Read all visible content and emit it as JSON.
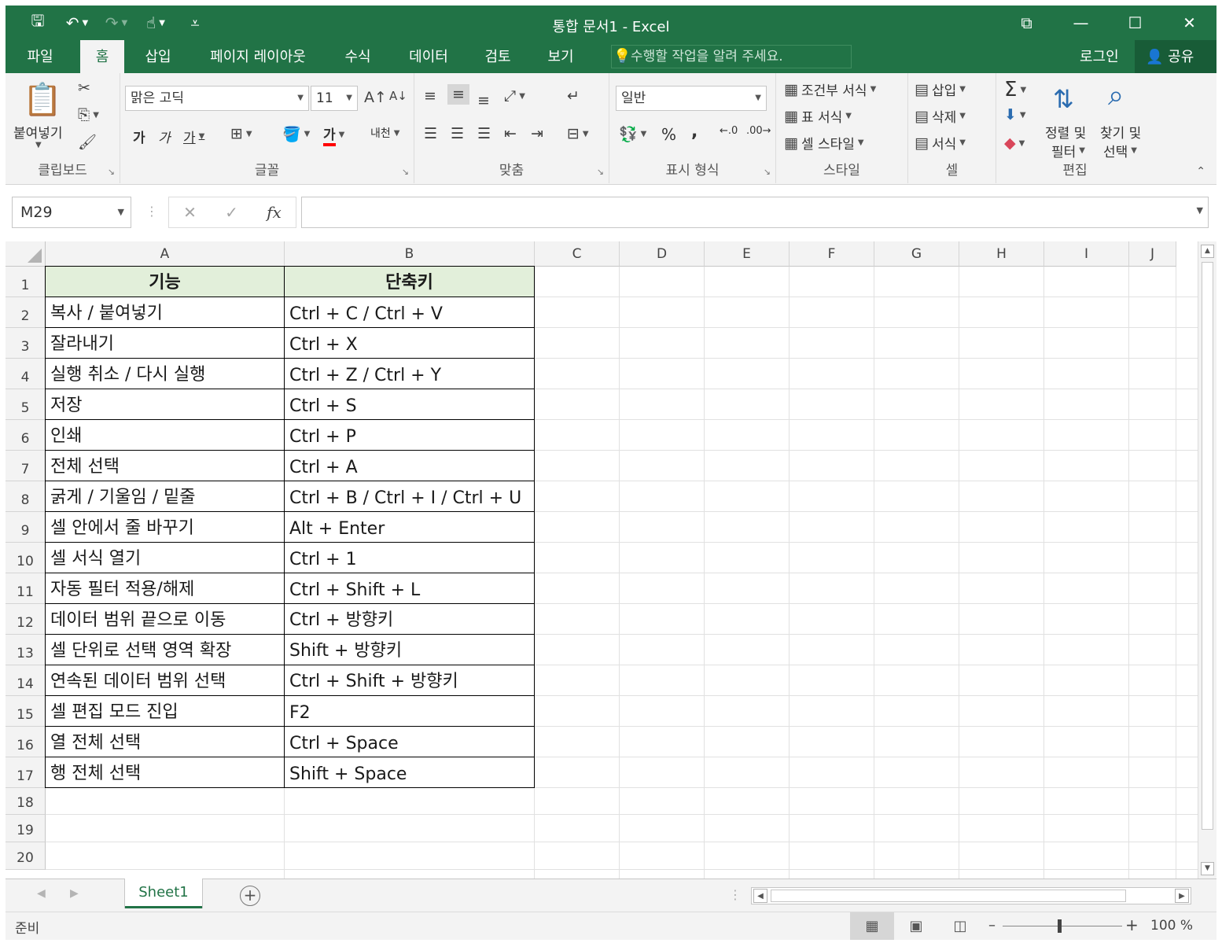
{
  "window": {
    "title": "통합 문서1 - Excel",
    "controls": [
      "⧉",
      "—",
      "☐",
      "✕"
    ]
  },
  "qat": {
    "save": "🖫",
    "undo": "↶",
    "redo": "↷",
    "touch": "☝",
    "customize": "⩡"
  },
  "tabs": [
    "파일",
    "홈",
    "삽입",
    "페이지 레이아웃",
    "수식",
    "데이터",
    "검토",
    "보기"
  ],
  "active_tab": "홈",
  "tellme": {
    "placeholder": "수행할 작업을 알려 주세요."
  },
  "account": {
    "login": "로그인",
    "share": "공유"
  },
  "ribbon": {
    "clipboard": {
      "label": "클립보드",
      "paste": "붙여넣기"
    },
    "font": {
      "label": "글꼴",
      "font_name": "맑은 고딕",
      "font_size": "11",
      "bold": "가",
      "italic": "가",
      "underline": "가",
      "font_color": "가",
      "phonetic": "내천"
    },
    "alignment": {
      "label": "맞춤"
    },
    "number": {
      "label": "표시 형식",
      "format": "일반",
      "percent": "%",
      "comma": ","
    },
    "styles": {
      "label": "스타일",
      "conditional": "조건부 서식",
      "table": "표 서식",
      "cell_styles": "셀 스타일"
    },
    "cells": {
      "label": "셀",
      "insert": "삽입",
      "delete": "삭제",
      "format": "서식"
    },
    "editing": {
      "label": "편집",
      "sort_filter_1": "정렬 및",
      "sort_filter_2": "필터",
      "find_1": "찾기 및",
      "find_2": "선택"
    }
  },
  "formula_bar": {
    "name_box": "M29",
    "content": ""
  },
  "columns": [
    "A",
    "B",
    "C",
    "D",
    "E",
    "F",
    "G",
    "H",
    "I",
    "J"
  ],
  "rows": [
    "1",
    "2",
    "3",
    "4",
    "5",
    "6",
    "7",
    "8",
    "9",
    "10",
    "11",
    "12",
    "13",
    "14",
    "15",
    "16",
    "17",
    "18",
    "19",
    "20"
  ],
  "table": {
    "headers": [
      "기능",
      "단축키"
    ],
    "rows": [
      [
        "복사 / 붙여넣기",
        "Ctrl + C / Ctrl + V"
      ],
      [
        "잘라내기",
        "Ctrl + X"
      ],
      [
        "실행 취소 / 다시 실행",
        "Ctrl + Z / Ctrl + Y"
      ],
      [
        "저장",
        "Ctrl + S"
      ],
      [
        "인쇄",
        "Ctrl + P"
      ],
      [
        "전체 선택",
        "Ctrl + A"
      ],
      [
        "굵게 / 기울임 / 밑줄",
        "Ctrl + B / Ctrl + I / Ctrl + U"
      ],
      [
        "셀 안에서 줄 바꾸기",
        "Alt + Enter"
      ],
      [
        "셀 서식 열기",
        "Ctrl + 1"
      ],
      [
        "자동 필터 적용/해제",
        "Ctrl + Shift + L"
      ],
      [
        "데이터 범위 끝으로 이동",
        "Ctrl + 방향키"
      ],
      [
        "셀 단위로 선택 영역 확장",
        "Shift + 방향키"
      ],
      [
        "연속된 데이터 범위 선택",
        "Ctrl + Shift + 방향키"
      ],
      [
        "셀 편집 모드 진입",
        "F2"
      ],
      [
        "열 전체 선택",
        "Ctrl + Space"
      ],
      [
        "행 전체 선택",
        "Shift + Space"
      ]
    ],
    "header_fill": "#e2efda"
  },
  "sheets": [
    "Sheet1"
  ],
  "status": {
    "text": "준비",
    "zoom": "100 %"
  },
  "colors": {
    "accent": "#217346",
    "ribbon_bg": "#f3f3f3"
  }
}
